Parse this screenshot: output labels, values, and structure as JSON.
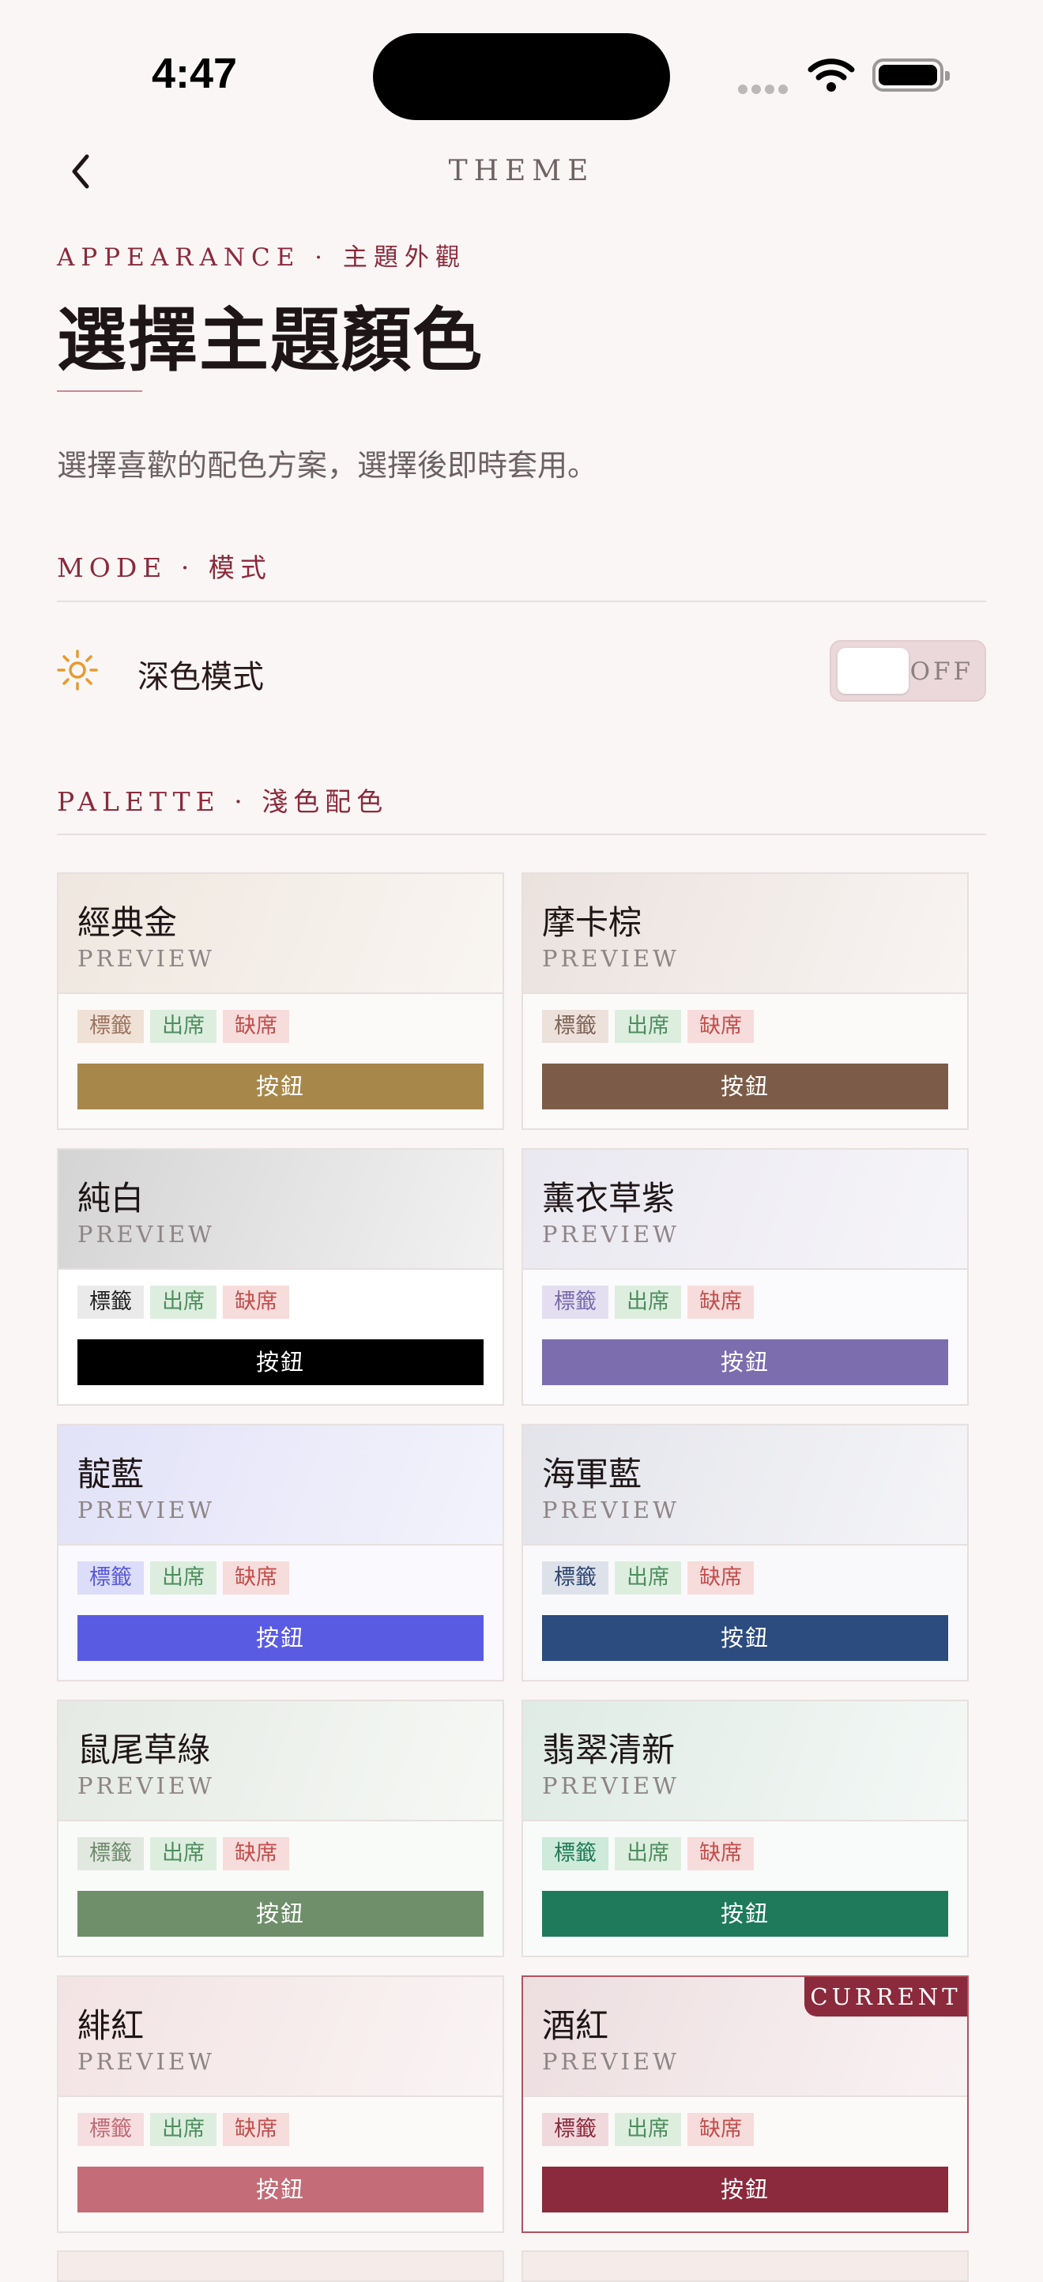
{
  "status": {
    "time": "4:47"
  },
  "nav": {
    "title": "THEME"
  },
  "header": {
    "eyebrow": "APPEARANCE · 主題外觀",
    "title": "選擇主題顏色",
    "subtitle": "選擇喜歡的配色方案，選擇後即時套用。"
  },
  "mode_section": {
    "label": "MODE · 模式",
    "dark_mode_label": "深色模式",
    "toggle_state": "OFF",
    "icon": "sun-icon"
  },
  "palette_section": {
    "label": "PALETTE · 淺色配色"
  },
  "card_labels": {
    "preview": "PREVIEW",
    "chip_tag": "標籤",
    "chip_present": "出席",
    "chip_absent": "缺席",
    "button": "按鈕",
    "current_badge": "CURRENT"
  },
  "palettes": [
    {
      "name": "經典金",
      "top_bg": "linear-gradient(110deg,#EFE7DF,#F9F5F1)",
      "body_bg": "#FCFAF8",
      "tag_bg": "#F0E1D6",
      "tag_fg": "#9C7460",
      "present_bg": "#DDEEDF",
      "present_fg": "#4E8E5E",
      "absent_bg": "#F7DCDC",
      "absent_fg": "#C0504D",
      "button_bg": "#A8874A"
    },
    {
      "name": "摩卡棕",
      "top_bg": "linear-gradient(110deg,#EBE2DE,#F8F4F2)",
      "body_bg": "#FCFAF9",
      "tag_bg": "#EDE1DB",
      "tag_fg": "#7E6458",
      "present_bg": "#DDEEDF",
      "present_fg": "#4E8E5E",
      "absent_bg": "#F7DCDC",
      "absent_fg": "#C0504D",
      "button_bg": "#7C5C48"
    },
    {
      "name": "純白",
      "top_bg": "linear-gradient(110deg,#D4D4D4,#F2F2F2)",
      "body_bg": "#FFFFFF",
      "tag_bg": "#EAEAEA",
      "tag_fg": "#222222",
      "present_bg": "#DDEEDF",
      "present_fg": "#4E8E5E",
      "absent_bg": "#F7DCDC",
      "absent_fg": "#C0504D",
      "button_bg": "#000000"
    },
    {
      "name": "薰衣草紫",
      "top_bg": "linear-gradient(110deg,#EAE8F0,#F6F5F9)",
      "body_bg": "#FBFAFC",
      "tag_bg": "#E3DFF0",
      "tag_fg": "#7A6BAE",
      "present_bg": "#DDEEDF",
      "present_fg": "#4E8E5E",
      "absent_bg": "#F7DCDC",
      "absent_fg": "#C0504D",
      "button_bg": "#7B6DAE"
    },
    {
      "name": "靛藍",
      "top_bg": "linear-gradient(110deg,#E2E2F8,#F3F3FC)",
      "body_bg": "#F9F9FE",
      "tag_bg": "#DCDDF8",
      "tag_fg": "#5658D8",
      "present_bg": "#DDEEDF",
      "present_fg": "#4E8E5E",
      "absent_bg": "#F7DCDC",
      "absent_fg": "#C0504D",
      "button_bg": "#5A5BE3"
    },
    {
      "name": "海軍藍",
      "top_bg": "linear-gradient(110deg,#E3E4EA,#F5F5F8)",
      "body_bg": "#F9F9FB",
      "tag_bg": "#DDE1EA",
      "tag_fg": "#2E4670",
      "present_bg": "#DDEEDF",
      "present_fg": "#4E8E5E",
      "absent_bg": "#F7DCDC",
      "absent_fg": "#C0504D",
      "button_bg": "#2C4B7E"
    },
    {
      "name": "鼠尾草綠",
      "top_bg": "linear-gradient(110deg,#E5EAE4,#F6F8F5)",
      "body_bg": "#F9FBF9",
      "tag_bg": "#E1E8E0",
      "tag_fg": "#6E8A6C",
      "present_bg": "#DDEEDF",
      "present_fg": "#4E8E5E",
      "absent_bg": "#F7DCDC",
      "absent_fg": "#C0504D",
      "button_bg": "#6F8E6A"
    },
    {
      "name": "翡翠清新",
      "top_bg": "linear-gradient(110deg,#DFEBE5,#F4F8F6)",
      "body_bg": "#F8FBF9",
      "tag_bg": "#CDEBD8",
      "tag_fg": "#1F7A57",
      "present_bg": "#DDEEDF",
      "present_fg": "#4E8E5E",
      "absent_bg": "#F7DCDC",
      "absent_fg": "#C0504D",
      "button_bg": "#1F7A5C"
    },
    {
      "name": "緋紅",
      "top_bg": "linear-gradient(110deg,#F3E3E4,#FAF4F4)",
      "body_bg": "#FCF9F9",
      "tag_bg": "#F6DEE0",
      "tag_fg": "#C06A75",
      "present_bg": "#DDEEDF",
      "present_fg": "#4E8E5E",
      "absent_bg": "#F7DCDC",
      "absent_fg": "#C0504D",
      "button_bg": "#C46C77"
    },
    {
      "name": "酒紅",
      "top_bg": "linear-gradient(110deg,#EDDEE0,#F9F2F3)",
      "body_bg": "#FCF9F9",
      "tag_bg": "#F0D9DD",
      "tag_fg": "#8B2A3C",
      "present_bg": "#DDEEDF",
      "present_fg": "#4E8E5E",
      "absent_bg": "#F7DCDC",
      "absent_fg": "#C0504D",
      "button_bg": "#8B2A3C",
      "current": true
    }
  ]
}
